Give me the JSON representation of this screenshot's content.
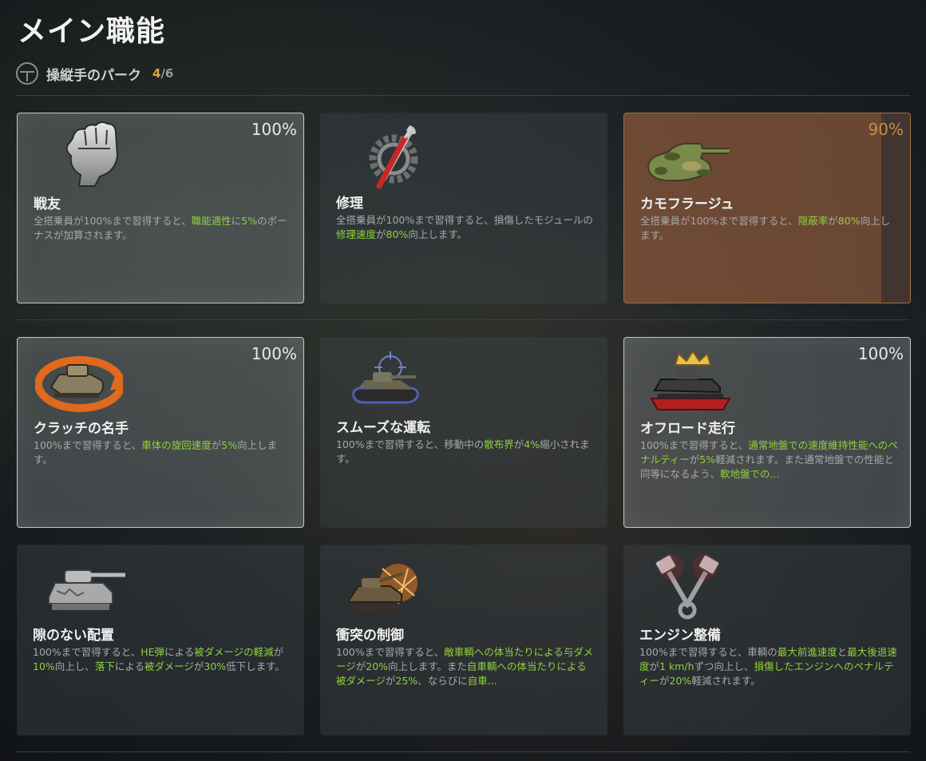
{
  "title": "メイン職能",
  "subheader": {
    "label": "操縦手のパーク",
    "count": "4",
    "total": "/6"
  },
  "cards": [
    {
      "name": "戦友",
      "pct": "100%",
      "desc": [
        {
          "t": "全搭乗員が100%まで習得すると、"
        },
        {
          "t": "職能適性",
          "h": 1
        },
        {
          "t": "に"
        },
        {
          "t": "5%",
          "h": 1
        },
        {
          "t": "のボーナスが加算されます。"
        }
      ]
    },
    {
      "name": "修理",
      "pct": "",
      "desc": [
        {
          "t": "全搭乗員が100%まで習得すると、損傷したモジュールの"
        },
        {
          "t": "修理速度",
          "h": 1
        },
        {
          "t": "が"
        },
        {
          "t": "80%",
          "h": 1
        },
        {
          "t": "向上します。"
        }
      ]
    },
    {
      "name": "カモフラージュ",
      "pct": "90%",
      "desc": [
        {
          "t": "全搭乗員が100%まで習得すると、"
        },
        {
          "t": "隠蔽率",
          "h": 1
        },
        {
          "t": "が"
        },
        {
          "t": "80%",
          "h": 1
        },
        {
          "t": "向上します。"
        }
      ]
    },
    {
      "name": "クラッチの名手",
      "pct": "100%",
      "desc": [
        {
          "t": "100%まで習得すると、"
        },
        {
          "t": "車体の旋回速度",
          "h": 1
        },
        {
          "t": "が"
        },
        {
          "t": "5%",
          "h": 1
        },
        {
          "t": "向上します。"
        }
      ]
    },
    {
      "name": "スムーズな運転",
      "pct": "",
      "desc": [
        {
          "t": "100%まで習得すると、移動中の"
        },
        {
          "t": "散布界",
          "h": 1
        },
        {
          "t": "が"
        },
        {
          "t": "4%",
          "h": 1
        },
        {
          "t": "縮小されます。"
        }
      ]
    },
    {
      "name": "オフロード走行",
      "pct": "100%",
      "desc": [
        {
          "t": "100%まで習得すると、"
        },
        {
          "t": "通常地盤での速度維持性能へのペナルティー",
          "h": 1
        },
        {
          "t": "が"
        },
        {
          "t": "5%",
          "h": 1
        },
        {
          "t": "軽減されます。また通常地盤での性能と同等になるよう、"
        },
        {
          "t": "軟地盤での...",
          "h": 1
        }
      ]
    },
    {
      "name": "隙のない配置",
      "pct": "",
      "desc": [
        {
          "t": "100%まで習得すると、"
        },
        {
          "t": "HE弾",
          "h": 1
        },
        {
          "t": "による"
        },
        {
          "t": "被ダメージの軽減",
          "h": 1
        },
        {
          "t": "が"
        },
        {
          "t": "10%",
          "h": 1
        },
        {
          "t": "向上し、"
        },
        {
          "t": "落下",
          "h": 1
        },
        {
          "t": "による"
        },
        {
          "t": "被ダメージ",
          "h": 1
        },
        {
          "t": "が"
        },
        {
          "t": "30%",
          "h": 1
        },
        {
          "t": "低下します。"
        }
      ]
    },
    {
      "name": "衝突の制御",
      "pct": "",
      "desc": [
        {
          "t": "100%まで習得すると、"
        },
        {
          "t": "敵車輌への体当たりによる与ダメージ",
          "h": 1
        },
        {
          "t": "が"
        },
        {
          "t": "20%",
          "h": 1
        },
        {
          "t": "向上します。また"
        },
        {
          "t": "自車輌への体当たりによる被ダメージ",
          "h": 1
        },
        {
          "t": "が"
        },
        {
          "t": "25%",
          "h": 1
        },
        {
          "t": "、ならびに"
        },
        {
          "t": "自車...",
          "h": 1
        }
      ]
    },
    {
      "name": "エンジン整備",
      "pct": "",
      "desc": [
        {
          "t": "100%まで習得すると、車輌の"
        },
        {
          "t": "最大前進速度",
          "h": 1
        },
        {
          "t": "と"
        },
        {
          "t": "最大後退速度",
          "h": 1
        },
        {
          "t": "が"
        },
        {
          "t": "1 km/h",
          "h": 1
        },
        {
          "t": "ずつ向上し、"
        },
        {
          "t": "損傷したエンジンへのペナルティー",
          "h": 1
        },
        {
          "t": "が"
        },
        {
          "t": "20%",
          "h": 1
        },
        {
          "t": "軽減されます。"
        }
      ]
    }
  ],
  "icons": [
    "fist-icon",
    "wrench-gear-icon",
    "camo-tank-icon",
    "clutch-tank-icon",
    "smooth-drive-tank-icon",
    "crowned-tank-icon",
    "armored-tank-icon",
    "ram-tank-icon",
    "pistons-icon"
  ],
  "colors": {
    "highlight": "#8fd13f",
    "count": "#d8a840",
    "camo_pct": "#c98d45"
  }
}
